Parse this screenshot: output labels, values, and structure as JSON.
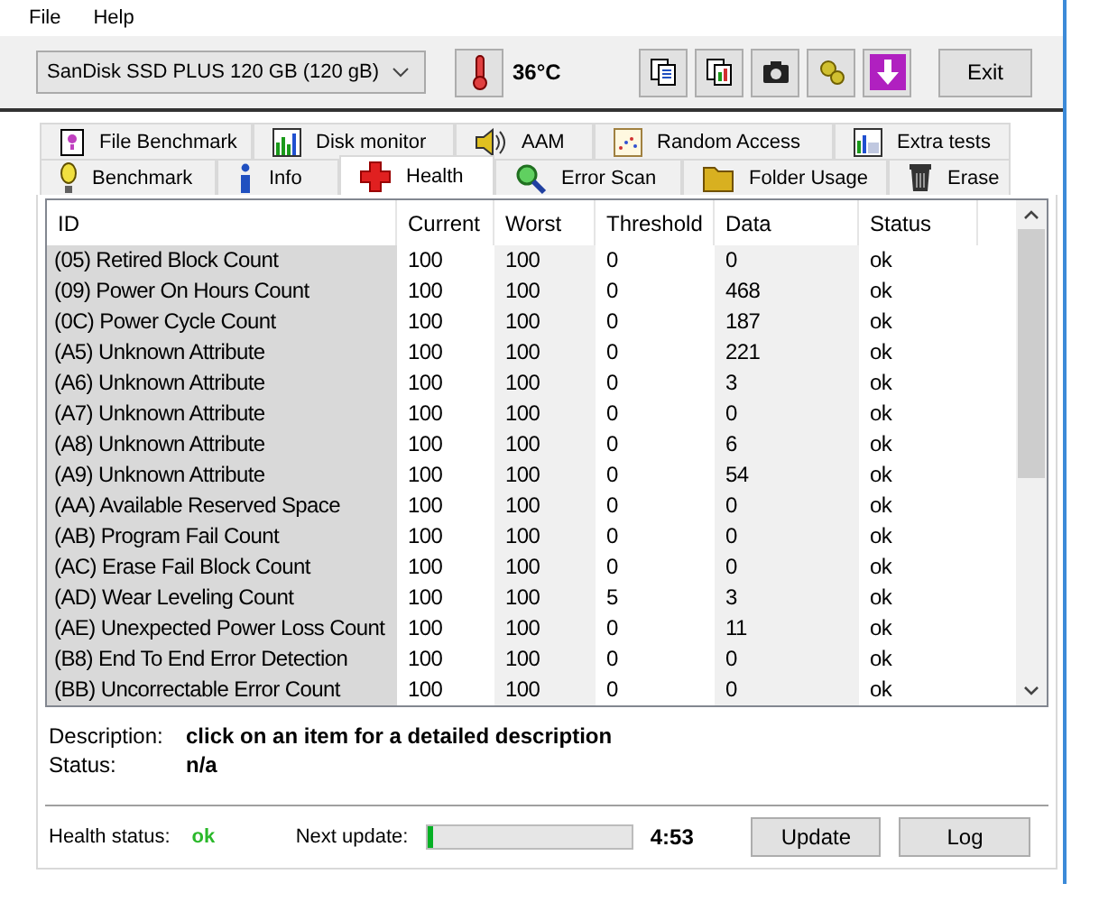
{
  "menu": [
    "File",
    "Help"
  ],
  "toolbar": {
    "drive": "SanDisk SSD PLUS 120 GB (120 gB)",
    "temperature": "36°C",
    "exit": "Exit"
  },
  "tabs_top": [
    {
      "label": "File Benchmark",
      "selected": false
    },
    {
      "label": "Disk monitor",
      "selected": false
    },
    {
      "label": "AAM",
      "selected": false
    },
    {
      "label": "Random Access",
      "selected": false
    },
    {
      "label": "Extra tests",
      "selected": false
    }
  ],
  "tabs_bottom": [
    {
      "label": "Benchmark",
      "selected": false
    },
    {
      "label": "Info",
      "selected": false
    },
    {
      "label": "Health",
      "selected": true
    },
    {
      "label": "Error Scan",
      "selected": false
    },
    {
      "label": "Folder Usage",
      "selected": false
    },
    {
      "label": "Erase",
      "selected": false
    }
  ],
  "table": {
    "columns": [
      "ID",
      "Current",
      "Worst",
      "Threshold",
      "Data",
      "Status"
    ],
    "rows": [
      [
        "(05) Retired Block Count",
        "100",
        "100",
        "0",
        "0",
        "ok"
      ],
      [
        "(09) Power On Hours Count",
        "100",
        "100",
        "0",
        "468",
        "ok"
      ],
      [
        "(0C) Power Cycle Count",
        "100",
        "100",
        "0",
        "187",
        "ok"
      ],
      [
        "(A5) Unknown Attribute",
        "100",
        "100",
        "0",
        "221",
        "ok"
      ],
      [
        "(A6) Unknown Attribute",
        "100",
        "100",
        "0",
        "3",
        "ok"
      ],
      [
        "(A7) Unknown Attribute",
        "100",
        "100",
        "0",
        "0",
        "ok"
      ],
      [
        "(A8) Unknown Attribute",
        "100",
        "100",
        "0",
        "6",
        "ok"
      ],
      [
        "(A9) Unknown Attribute",
        "100",
        "100",
        "0",
        "54",
        "ok"
      ],
      [
        "(AA) Available Reserved Space",
        "100",
        "100",
        "0",
        "0",
        "ok"
      ],
      [
        "(AB) Program Fail Count",
        "100",
        "100",
        "0",
        "0",
        "ok"
      ],
      [
        "(AC) Erase Fail Block Count",
        "100",
        "100",
        "0",
        "0",
        "ok"
      ],
      [
        "(AD) Wear Leveling Count",
        "100",
        "100",
        "5",
        "3",
        "ok"
      ],
      [
        "(AE) Unexpected Power Loss Count",
        "100",
        "100",
        "0",
        "11",
        "ok"
      ],
      [
        "(B8) End To End Error Detection",
        "100",
        "100",
        "0",
        "0",
        "ok"
      ],
      [
        "(BB) Uncorrectable Error Count",
        "100",
        "100",
        "0",
        "0",
        "ok"
      ]
    ]
  },
  "details": {
    "description_label": "Description:",
    "description": "click on an item for a detailed description",
    "status_label": "Status:",
    "status": "n/a"
  },
  "footer": {
    "health_label": "Health status:",
    "health": "ok",
    "next_update_label": "Next update:",
    "level": 0.02,
    "time": "4:53",
    "update": "Update",
    "log": "Log"
  }
}
